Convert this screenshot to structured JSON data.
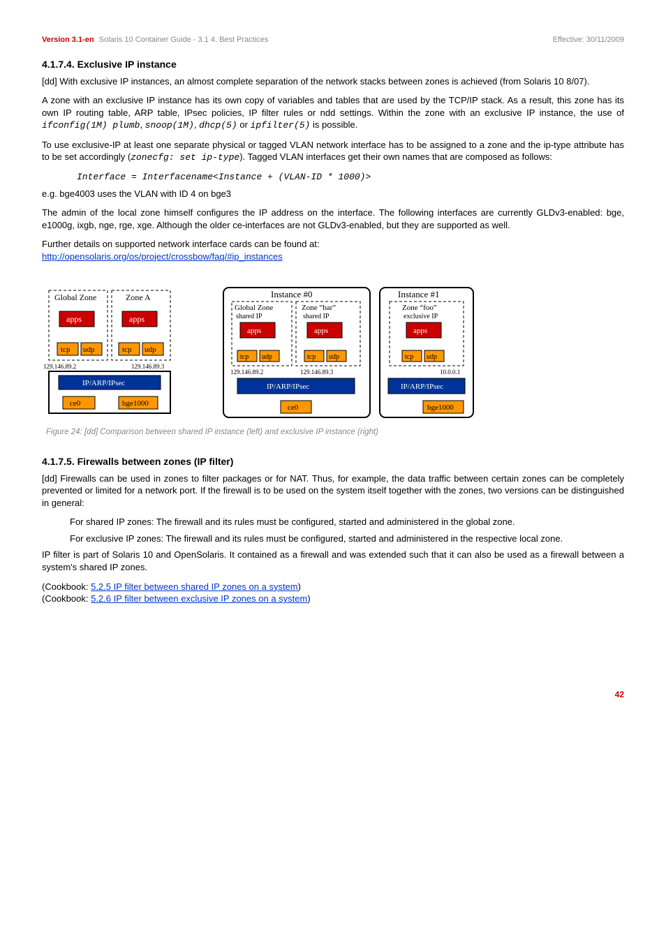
{
  "header": {
    "version": "Version 3.1-en",
    "doc": "  Solaris 10 Container Guide - 3.1   4. Best Practices",
    "effective": "Effective: 30/11/2009"
  },
  "s1": {
    "heading": "4.1.7.4. Exclusive IP instance",
    "p1": "[dd] With exclusive IP instances, an almost complete separation of the network stacks between zones is achieved (from Solaris 10 8/07).",
    "p2a": "A zone with an exclusive IP instance has its own copy of variables and tables that are used by the TCP/IP stack. As a result, this zone has its own IP routing table, ARP table, IPsec policies, IP filter rules or ndd settings. Within the zone with an exclusive IP instance, the use of ",
    "cmd1": "ifconfig(1M) plumb",
    "cmd2": "snoop(1M)",
    "cmd3": "dhcp(5)",
    "cmd4": "ipfilter(5)",
    "p2b": " is possible.",
    "p3a": "To use exclusive-IP at least one separate physical or tagged VLAN network interface has to be assigned to a zone  and the ip-type attribute has to be set accordingly (",
    "cmd5": "zonecfg: set ip-type",
    "p3b": "). Tagged VLAN interfaces get their own names that are composed as follows:",
    "formula": "Interface = Interfacename<Instance + (VLAN-ID * 1000)>",
    "p4": "e.g. bge4003 uses the VLAN with ID 4 on bge3",
    "p5": "The admin of the local zone himself configures the IP address on the interface. The following interfaces are currently GLDv3-enabled: bge, e1000g, ixgb, nge, rge, xge. Although the older ce-interfaces are not GLDv3-enabled, but they are supported as well.",
    "p6": "Further details on supported network interface cards can be found at:",
    "link1": "http://opensolaris.org/os/project/crossbow/faq/#ip_instances"
  },
  "figcap": "Figure 24: [dd] Comparison between shared IP instance (left) and exclusive IP instance (right)",
  "s2": {
    "heading": "4.1.7.5. Firewalls between zones (IP filter)",
    "p1": "[dd] Firewalls can be used in zones to filter packages or for NAT. Thus, for example, the data traffic between certain zones can be completely prevented or limited for a network port. If the firewall is to be used on the system itself together with the zones, two versions can be distinguished in general:",
    "li1": "For shared IP zones: The firewall and its rules must be configured, started and administered in the global zone.",
    "li2": "For exclusive IP zones: The firewall and its rules must be configured, started and administered in the respective local zone.",
    "p2": "IP filter is part of Solaris 10 and OpenSolaris. It contained as a firewall and was extended such that it can also be used as a firewall between a system's shared IP zones.",
    "cb1a": "(Cookbook: ",
    "cb1link": "5.2.5 IP filter between shared IP zones on a system",
    "cb1b": ")",
    "cb2a": "(Cookbook: ",
    "cb2link": "5.2.6 IP filter between exclusive IP zones on a system",
    "cb2b": ")"
  },
  "chart_data": [
    {
      "type": "diagram",
      "title": "Shared IP instance",
      "zones": [
        "Global Zone",
        "Zone A"
      ],
      "boxes_per_zone": [
        "apps",
        "tcp",
        "udp"
      ],
      "ips": [
        "129.146.89.2",
        "129.146.89.3"
      ],
      "stack": "IP/ARP/IPsec",
      "nics": [
        "ce0",
        "bge1000"
      ]
    },
    {
      "type": "diagram",
      "title": "Exclusive IP instance",
      "instances": [
        {
          "name": "Instance #0",
          "zones": [
            "Global Zone",
            "Zone \"bar\""
          ],
          "shared": "shared IP",
          "boxes_per_zone": [
            "apps",
            "tcp",
            "udp"
          ],
          "ips": [
            "129.146.89.2",
            "129.146.89.3"
          ],
          "stack": "IP/ARP/IPsec",
          "nics": [
            "ce0"
          ]
        },
        {
          "name": "Instance #1",
          "zones": [
            "Zone \"foo\""
          ],
          "exclusive": "exclusive IP",
          "boxes_per_zone": [
            "apps",
            "tcp",
            "udp"
          ],
          "ips": [
            "10.0.0.1"
          ],
          "stack": "IP/ARP/IPsec",
          "nics": [
            "bge1000"
          ]
        }
      ]
    }
  ],
  "pagenum": "42"
}
